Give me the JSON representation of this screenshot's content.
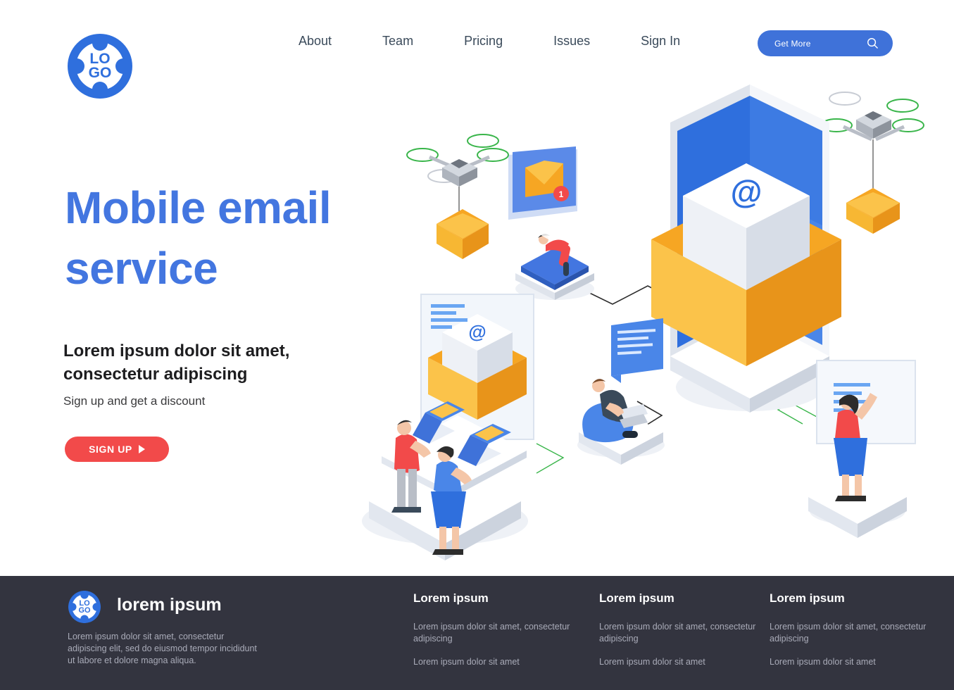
{
  "header": {
    "logo": {
      "line1": "LO",
      "line2": "GO",
      "name": "logo"
    },
    "nav": [
      {
        "label": "About"
      },
      {
        "label": "Team"
      },
      {
        "label": "Pricing"
      },
      {
        "label": "Issues"
      },
      {
        "label": "Sign In"
      }
    ],
    "cta": {
      "label": "Get More",
      "icon": "search-icon",
      "bg": "#3f72d9"
    }
  },
  "hero": {
    "title": "Mobile email service",
    "subtitle": "Lorem ipsum dolor sit amet, consectetur adipiscing",
    "note": "Sign up and get a discount",
    "button": {
      "label": "SIGN UP",
      "bg": "#f24a4a",
      "icon": "play-icon"
    },
    "title_color": "#4376e0"
  },
  "illustration": {
    "name": "isometric-mobile-email-illustration",
    "elements": [
      "smartphone-with-email",
      "open-envelope-at-symbol",
      "notification-envelope-badge",
      "drone-left",
      "drone-right",
      "hanging-envelope-left",
      "hanging-envelope-right",
      "monitor-envelope-at",
      "chat-bubble-screen",
      "desk-two-laptops",
      "person-beanbag-laptop",
      "person-at-whiteboard",
      "person-reading-on-book"
    ],
    "badge_count": "1",
    "at_symbol": "@"
  },
  "footer": {
    "bg": "#33343f",
    "logo": {
      "line1": "LO",
      "line2": "GO"
    },
    "brand": "lorem ipsum",
    "description": "Lorem ipsum dolor sit amet, consectetur adipiscing elit, sed do eiusmod tempor incididunt ut labore et dolore magna aliqua.",
    "columns": [
      {
        "heading": "Lorem ipsum",
        "links": [
          "Lorem ipsum dolor sit amet, consectetur adipiscing",
          "Lorem ipsum dolor sit amet"
        ]
      },
      {
        "heading": "Lorem ipsum",
        "links": [
          "Lorem ipsum dolor sit amet, consectetur adipiscing",
          "Lorem ipsum dolor sit amet"
        ]
      },
      {
        "heading": "Lorem ipsum",
        "links": [
          "Lorem ipsum dolor sit amet, consectetur adipiscing",
          "Lorem ipsum dolor sit amet"
        ]
      }
    ]
  }
}
